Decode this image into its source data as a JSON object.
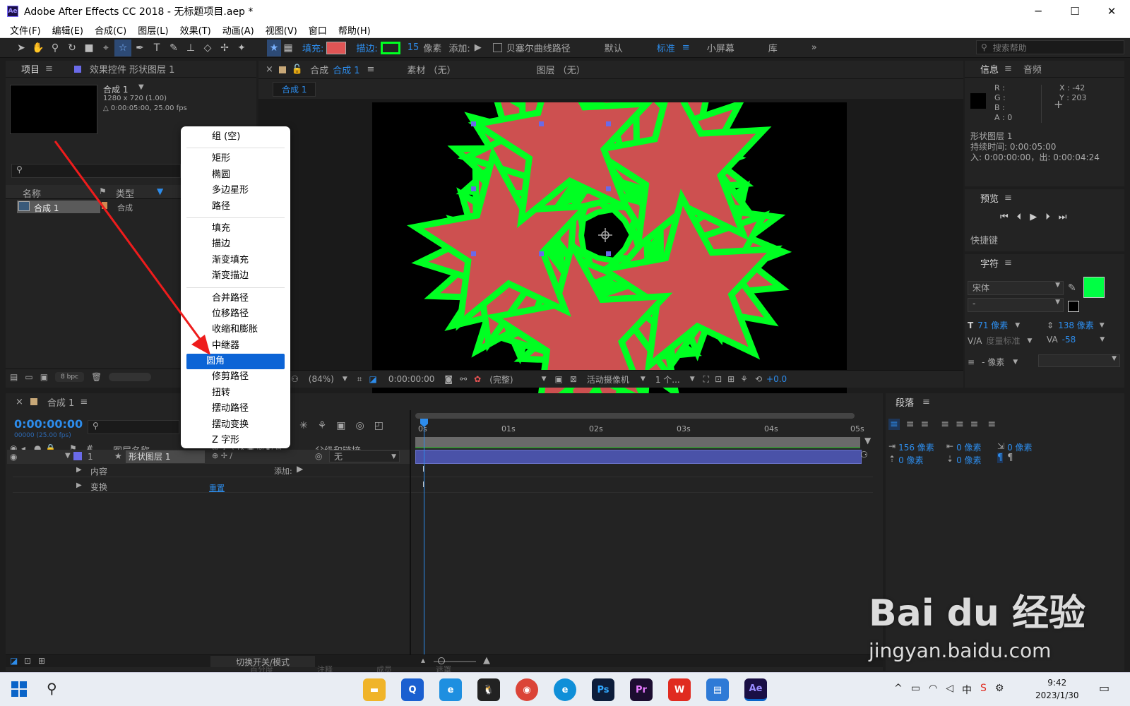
{
  "window": {
    "title": "Adobe After Effects CC 2018 - 无标题项目.aep *",
    "app_icon": "Ae",
    "controls": [
      "─",
      "☐",
      "✕"
    ]
  },
  "menu": [
    "文件(F)",
    "编辑(E)",
    "合成(C)",
    "图层(L)",
    "效果(T)",
    "动画(A)",
    "视图(V)",
    "窗口",
    "帮助(H)"
  ],
  "toolbar": {
    "fill_label": "填充:",
    "fill_color": "#e05555",
    "stroke_label": "描边:",
    "stroke_color": "#00ff22",
    "stroke_width": "15",
    "stroke_unit": "像素",
    "add_label": "添加:",
    "bezier_label": "贝塞尔曲线路径",
    "workspaces": [
      "默认",
      "标准",
      "小屏幕",
      "库"
    ],
    "active_workspace": "标准",
    "search_placeholder": "搜索帮助"
  },
  "project_panel": {
    "tab_project": "项目",
    "tab_effects": "效果控件 形状图层 1",
    "comp_name": "合成 1",
    "comp_size": "1280 x 720 (1.00)",
    "comp_duration": "△ 0:00:05:00, 25.00 fps",
    "col_name": "名称",
    "col_type": "类型",
    "item_name": "合成 1",
    "item_type": "合成",
    "bpc": "8 bpc"
  },
  "comp_panel": {
    "tab_comp": "合成",
    "tab_comp_name": "合成 1",
    "tab_footage": "素材 （无）",
    "tab_layer": "图层 （无）",
    "breadcrumb": "合成 1",
    "zoom": "(84%)",
    "timecode": "0:00:00:00",
    "resolution": "(完整)",
    "camera": "活动摄像机",
    "views": "1 个...",
    "exposure": "+0.0"
  },
  "info_panel": {
    "tab_info": "信息",
    "tab_audio": "音频",
    "r": "R :",
    "g": "G :",
    "b": "B :",
    "a": "A :  0",
    "x": "X : -42",
    "y": "Y : 203",
    "layer": "形状图层 1",
    "duration": "持续时间: 0:00:05:00",
    "inout": "入: 0:00:00:00，出: 0:00:04:24"
  },
  "preview_panel": {
    "title": "预览",
    "shortcut": "快捷键"
  },
  "char_panel": {
    "title": "字符",
    "font": "宋体",
    "style": "-",
    "size": "71 像素",
    "leading": "138 像素",
    "kerning": "度量标准",
    "tracking": "-58",
    "stroke": "- 像素",
    "fill_color": "#00ff44"
  },
  "para_panel": {
    "title": "段落",
    "indent_left": "156 像素",
    "indent_right": "0 像素",
    "indent_first": "0 像素",
    "space_before": "0 像素",
    "space_after": "0 像素"
  },
  "timeline": {
    "tab": "合成 1",
    "timecode": "0:00:00:00",
    "fps": "00000 (25.00 fps)",
    "col_name": "图层名称",
    "col_parent": "父级和链接",
    "col_num": "#",
    "layer_num": "1",
    "layer_name": "形状图层 1",
    "parent": "无",
    "content": "内容",
    "add": "添加:",
    "transform": "变换",
    "reset": "重置",
    "ruler": [
      "0s",
      "01s",
      "02s",
      "03s",
      "04s",
      "05s"
    ],
    "toggle": "切换开关/模式"
  },
  "context_menu": {
    "groups": [
      [
        "组 (空)"
      ],
      [
        "矩形",
        "椭圆",
        "多边星形",
        "路径"
      ],
      [
        "填充",
        "描边",
        "渐变填充",
        "渐变描边"
      ],
      [
        "合并路径",
        "位移路径",
        "收缩和膨胀",
        "中继器",
        "圆角",
        "修剪路径",
        "扭转",
        "摆动路径",
        "摆动变换",
        "Z 字形"
      ]
    ],
    "selected": "圆角"
  },
  "bottom_tabs": [
    "百分度",
    "注释",
    "成员",
    "遮罩"
  ],
  "watermark": {
    "logo": "Bai du 经验",
    "url": "jingyan.baidu.com"
  },
  "taskbar": {
    "time": "9:42",
    "date": "2023/1/30",
    "ime": "中"
  }
}
